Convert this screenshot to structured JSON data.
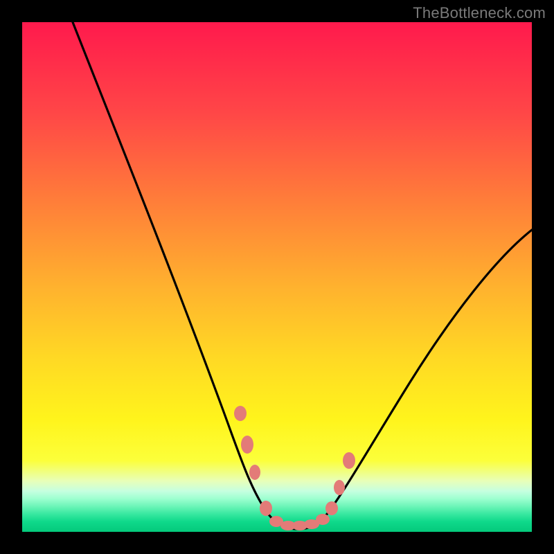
{
  "watermark": "TheBottleneck.com",
  "chart_data": {
    "type": "line",
    "title": "",
    "xlabel": "",
    "ylabel": "",
    "xlim": [
      0,
      100
    ],
    "ylim": [
      0,
      100
    ],
    "series": [
      {
        "name": "curve",
        "x": [
          10,
          15,
          20,
          25,
          30,
          35,
          40,
          42,
          45,
          48,
          50,
          52,
          55,
          58,
          60,
          65,
          70,
          75,
          80,
          85,
          90,
          95,
          100
        ],
        "y": [
          100,
          90,
          80,
          70,
          59,
          47,
          33,
          26,
          14,
          4,
          0.5,
          0.3,
          0.3,
          0.5,
          3,
          13,
          22,
          30,
          37,
          43,
          49,
          54,
          59
        ]
      }
    ],
    "markers": {
      "name": "highlight-dots",
      "x": [
        42.5,
        44,
        45.5,
        48,
        50,
        52,
        54,
        56,
        58.5,
        60,
        61.5,
        63.5
      ],
      "y": [
        23,
        16,
        12,
        4,
        1,
        1,
        1,
        1,
        1.5,
        3.5,
        8,
        14
      ]
    },
    "gradient_stops": [
      {
        "pos": 0,
        "color": "#ff1a4d"
      },
      {
        "pos": 0.18,
        "color": "#ff4747"
      },
      {
        "pos": 0.52,
        "color": "#ffb22e"
      },
      {
        "pos": 0.78,
        "color": "#fff41c"
      },
      {
        "pos": 0.92,
        "color": "#c6ffe0"
      },
      {
        "pos": 1.0,
        "color": "#04c97c"
      }
    ]
  }
}
